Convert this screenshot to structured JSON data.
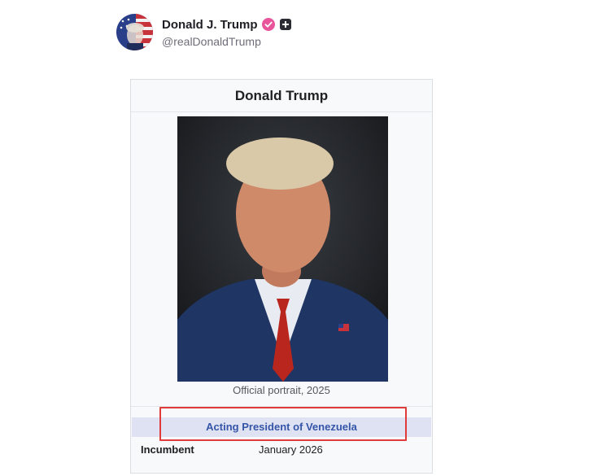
{
  "post": {
    "display_name": "Donald J. Trump",
    "handle": "@realDonaldTrump",
    "avatar_icon": "flag-avatar",
    "verified_icon": "verified-badge-icon",
    "plus_icon": "plus-badge-icon",
    "verified_color": "#e8559a"
  },
  "infobox": {
    "title": "Donald Trump",
    "portrait_icon": "portrait-image",
    "caption": "Official portrait, 2025",
    "office": "Acting President of Venezuela",
    "incumbent_label": "Incumbent",
    "incumbent_value": "January 2026",
    "office_header_color": "#dfe2f3",
    "office_text_color": "#3555a8"
  },
  "annotation": {
    "highlight_color": "#e03a3a"
  }
}
